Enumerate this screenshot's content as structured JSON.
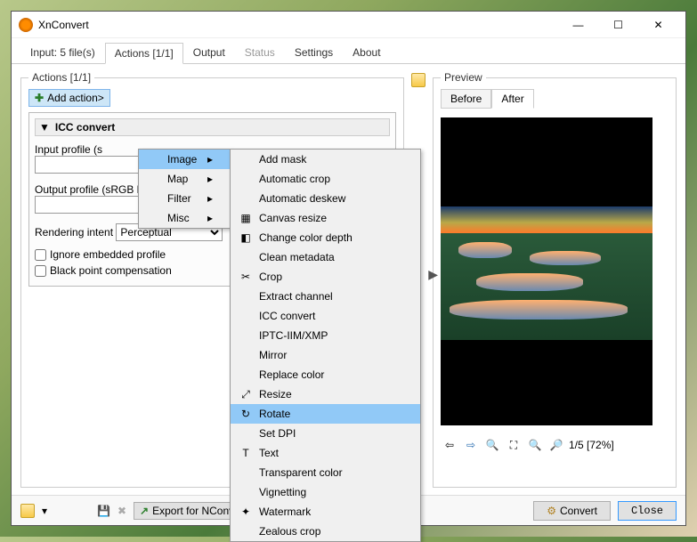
{
  "window": {
    "title": "XnConvert"
  },
  "winbtns": {
    "min": "—",
    "max": "☐",
    "close": "✕"
  },
  "tabs": [
    {
      "label": "Input: 5 file(s)"
    },
    {
      "label": "Actions [1/1]",
      "active": true
    },
    {
      "label": "Output"
    },
    {
      "label": "Status",
      "dim": true
    },
    {
      "label": "Settings"
    },
    {
      "label": "About"
    }
  ],
  "actions": {
    "legend": "Actions [1/1]",
    "add_label": "Add action>",
    "header": "ICC convert",
    "input_profile_label": "Input profile (s",
    "output_profile_label": "Output profile (sRGB by default)",
    "rendering_label": "Rendering intent",
    "rendering_value": "Perceptual",
    "chk1": "Ignore embedded profile",
    "chk2": "Black point compensation"
  },
  "catmenu": [
    {
      "label": "Image",
      "hl": true
    },
    {
      "label": "Map"
    },
    {
      "label": "Filter"
    },
    {
      "label": "Misc"
    }
  ],
  "submenu": [
    {
      "label": "Add mask"
    },
    {
      "label": "Automatic crop"
    },
    {
      "label": "Automatic deskew"
    },
    {
      "label": "Canvas resize",
      "icon": "canvas"
    },
    {
      "label": "Change color depth",
      "icon": "depth"
    },
    {
      "label": "Clean metadata"
    },
    {
      "label": "Crop",
      "icon": "crop"
    },
    {
      "label": "Extract channel"
    },
    {
      "label": "ICC convert"
    },
    {
      "label": "IPTC-IIM/XMP"
    },
    {
      "label": "Mirror"
    },
    {
      "label": "Replace color"
    },
    {
      "label": "Resize",
      "icon": "resize"
    },
    {
      "label": "Rotate",
      "icon": "rotate",
      "hl": true
    },
    {
      "label": "Set DPI"
    },
    {
      "label": "Text",
      "icon": "text"
    },
    {
      "label": "Transparent color"
    },
    {
      "label": "Vignetting"
    },
    {
      "label": "Watermark",
      "icon": "wm"
    },
    {
      "label": "Zealous crop"
    }
  ],
  "preview": {
    "legend": "Preview",
    "tab_before": "Before",
    "tab_after": "After",
    "status": "1/5 [72%]"
  },
  "foot": {
    "export": "Export for NConvert...",
    "convert": "Convert",
    "close": "Close"
  }
}
